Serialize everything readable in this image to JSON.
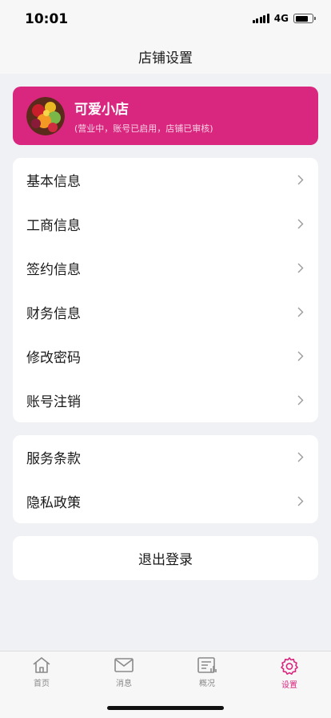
{
  "status_bar": {
    "time": "10:01",
    "network": "4G"
  },
  "nav": {
    "title": "店铺设置"
  },
  "shop": {
    "name": "可爱小店",
    "status": "(营业中，账号已启用，店铺已审核)",
    "card_color": "#d9267f"
  },
  "menu_group_1": [
    {
      "label": "基本信息"
    },
    {
      "label": "工商信息"
    },
    {
      "label": "签约信息"
    },
    {
      "label": "财务信息"
    },
    {
      "label": "修改密码"
    },
    {
      "label": "账号注销"
    }
  ],
  "menu_group_2": [
    {
      "label": "服务条款"
    },
    {
      "label": "隐私政策"
    }
  ],
  "logout": {
    "label": "退出登录"
  },
  "tabs": [
    {
      "label": "首页",
      "icon": "home-icon",
      "active": false
    },
    {
      "label": "消息",
      "icon": "mail-icon",
      "active": false
    },
    {
      "label": "概况",
      "icon": "overview-icon",
      "active": false
    },
    {
      "label": "设置",
      "icon": "gear-icon",
      "active": true
    }
  ],
  "colors": {
    "accent": "#d9267f",
    "background": "#f0f1f5"
  }
}
